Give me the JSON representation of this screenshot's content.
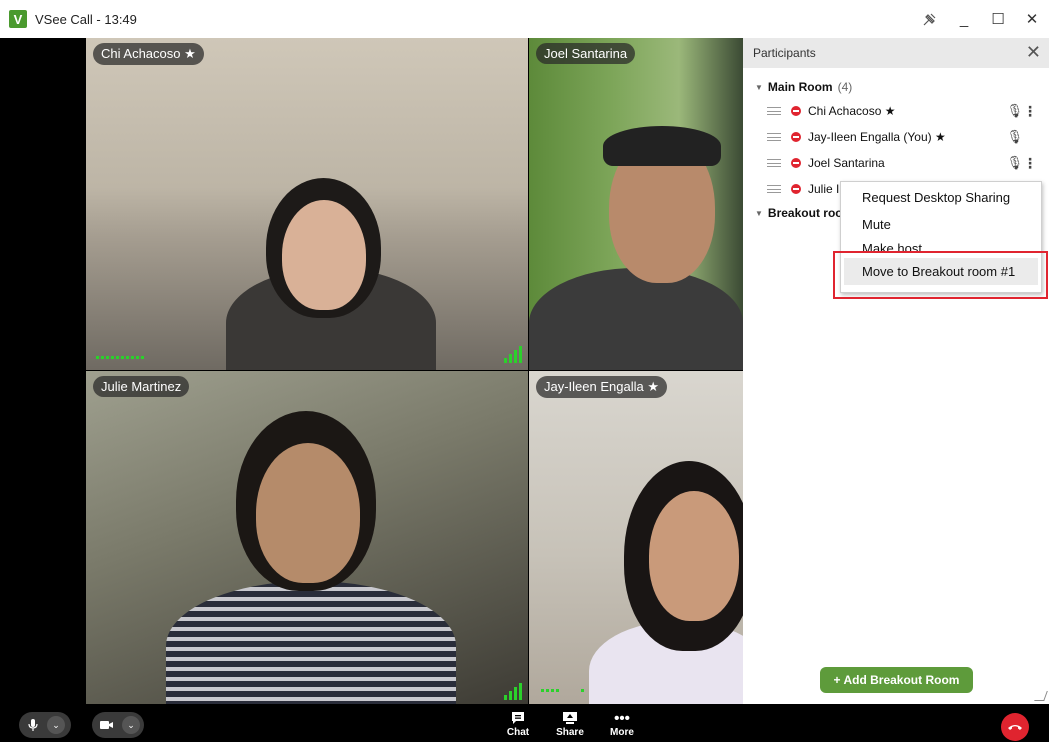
{
  "window": {
    "logo_letter": "V",
    "title": "VSee Call - 13:49",
    "pin_icon": "pin-icon",
    "minimize": "_",
    "maximize": "☐",
    "close": "✕"
  },
  "videos": [
    {
      "name": "Chi Achacoso ★"
    },
    {
      "name": "Joel Santarina"
    },
    {
      "name": "Julie Martinez"
    },
    {
      "name": "Jay-Ileen Engalla ★"
    }
  ],
  "panel": {
    "title": "Participants",
    "close": "✕",
    "main_room": {
      "name": "Main Room",
      "count": "(4)"
    },
    "participants": [
      {
        "name": "Chi Achacoso ★"
      },
      {
        "name": "Jay-Ileen Engalla (You) ★"
      },
      {
        "name": "Joel Santarina"
      },
      {
        "name": "Julie I"
      }
    ],
    "breakout_room": {
      "name": "Breakout roo"
    },
    "add_room_label": "+ Add Breakout Room"
  },
  "context_menu": {
    "items": [
      "Request Desktop Sharing",
      "Mute",
      "Make host",
      "Move to Breakout room #1"
    ]
  },
  "toolbar": {
    "chat": "Chat",
    "share": "Share",
    "more": "More"
  },
  "colors": {
    "accent_green": "#5e9b3b",
    "end_call_red": "#e0242f",
    "highlight_red": "#e0242f"
  }
}
